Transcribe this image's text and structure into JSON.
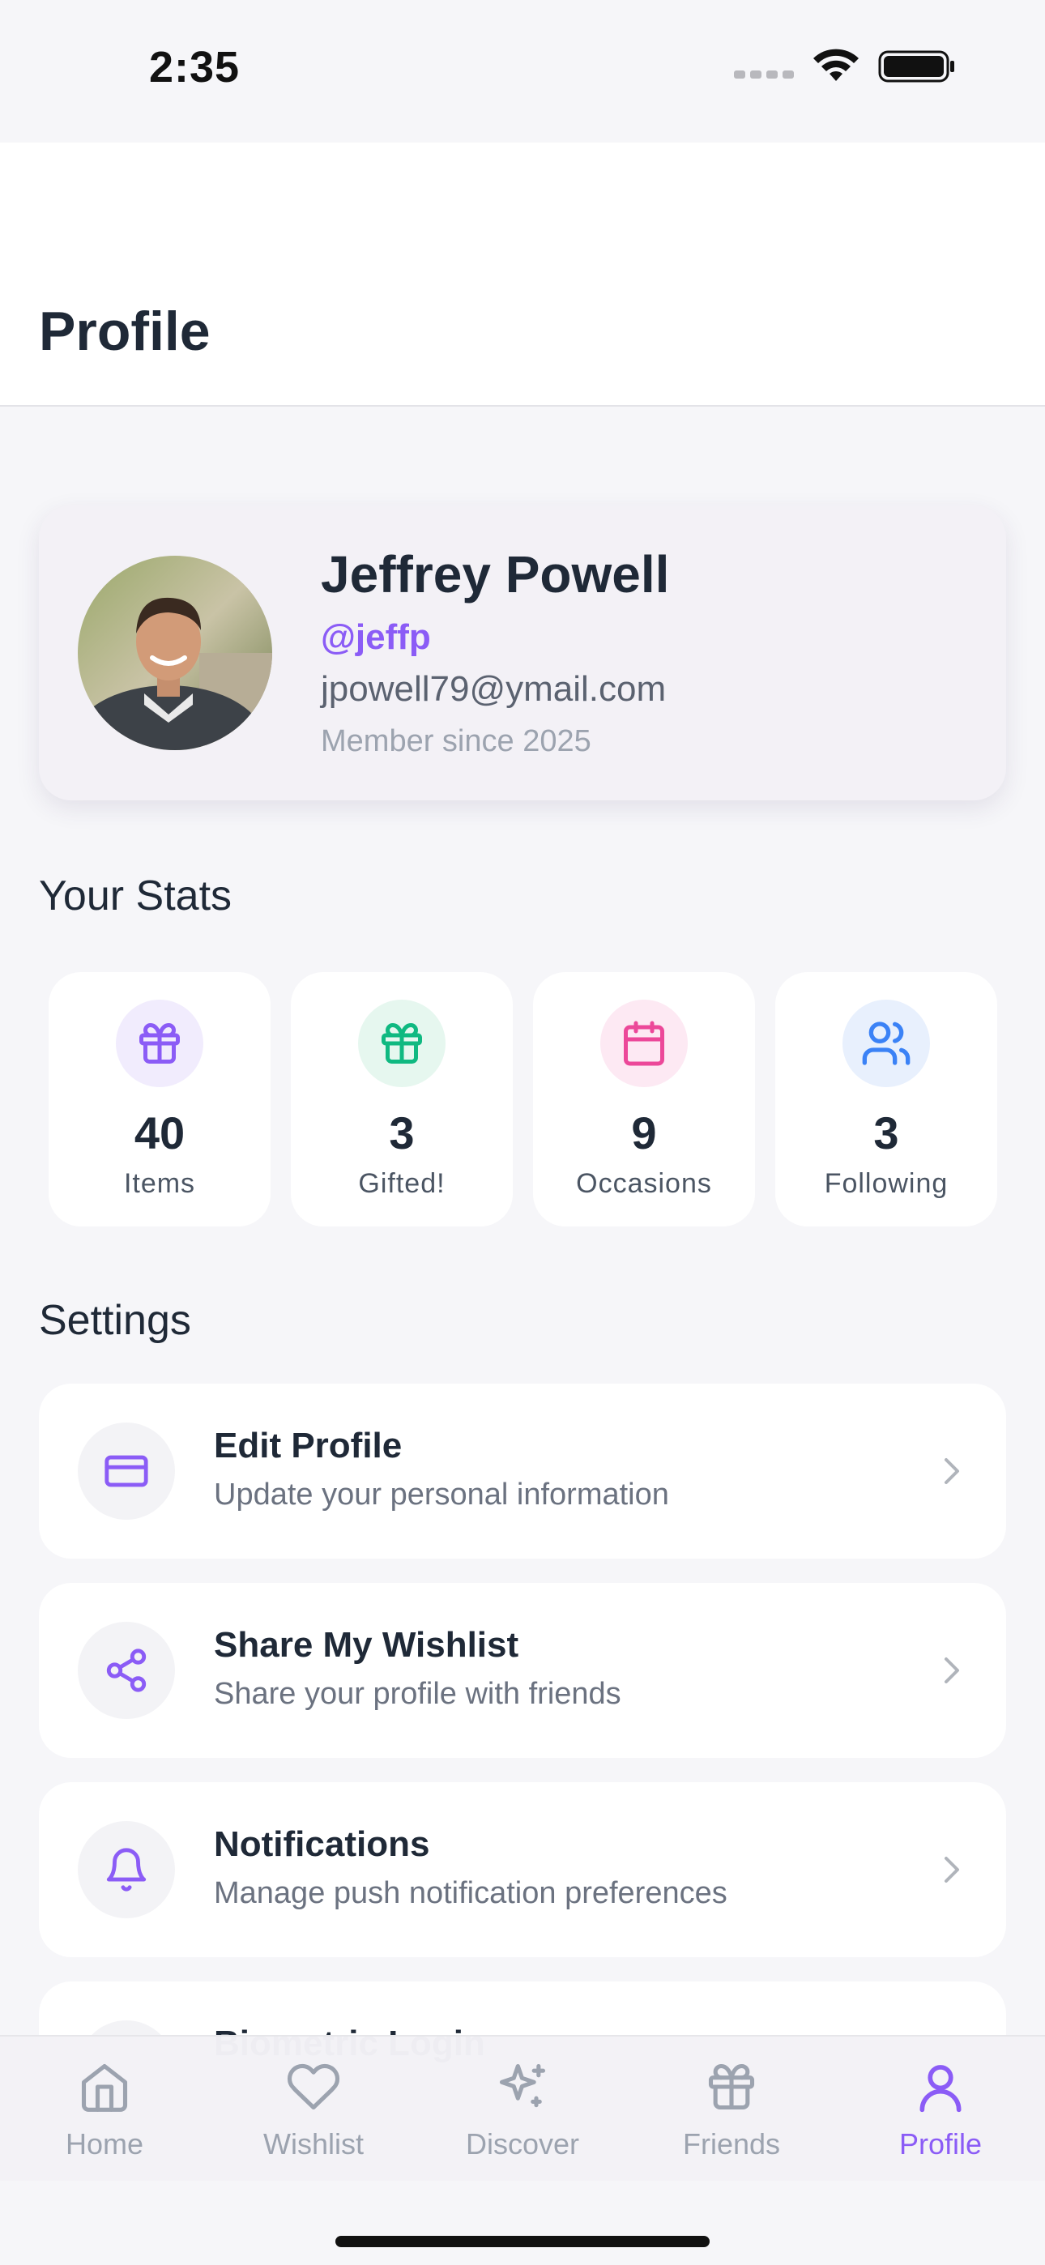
{
  "status_bar": {
    "time": "2:35"
  },
  "header": {
    "title": "Profile"
  },
  "profile": {
    "name": "Jeffrey Powell",
    "handle": "@jeffp",
    "email": "jpowell79@ymail.com",
    "member_since": "Member since 2025"
  },
  "stats": {
    "title": "Your Stats",
    "items": [
      {
        "value": "40",
        "label": "Items",
        "icon": "gift-icon",
        "color": "#8b5cf6",
        "bg": "#f1ecfd"
      },
      {
        "value": "3",
        "label": "Gifted!",
        "icon": "gift-icon",
        "color": "#10b981",
        "bg": "#e6f7ef"
      },
      {
        "value": "9",
        "label": "Occasions",
        "icon": "calendar-icon",
        "color": "#ec4899",
        "bg": "#fde9f3"
      },
      {
        "value": "3",
        "label": "Following",
        "icon": "users-icon",
        "color": "#3b82f6",
        "bg": "#e8f0fd"
      }
    ]
  },
  "settings": {
    "title": "Settings",
    "items": [
      {
        "title": "Edit Profile",
        "subtitle": "Update your personal information",
        "icon": "credit-card-icon"
      },
      {
        "title": "Share My Wishlist",
        "subtitle": "Share your profile with friends",
        "icon": "share-icon"
      },
      {
        "title": "Notifications",
        "subtitle": "Manage push notification preferences",
        "icon": "bell-icon"
      },
      {
        "title": "Biometric Login",
        "subtitle": "",
        "icon": "fingerprint-icon"
      }
    ]
  },
  "tabbar": {
    "tabs": [
      {
        "label": "Home",
        "icon": "home-icon",
        "active": false
      },
      {
        "label": "Wishlist",
        "icon": "heart-icon",
        "active": false
      },
      {
        "label": "Discover",
        "icon": "sparkles-icon",
        "active": false
      },
      {
        "label": "Friends",
        "icon": "gift-icon",
        "active": false
      },
      {
        "label": "Profile",
        "icon": "user-icon",
        "active": true
      }
    ]
  },
  "colors": {
    "accent": "#8b5cf6",
    "inactive": "#9ca3af"
  }
}
